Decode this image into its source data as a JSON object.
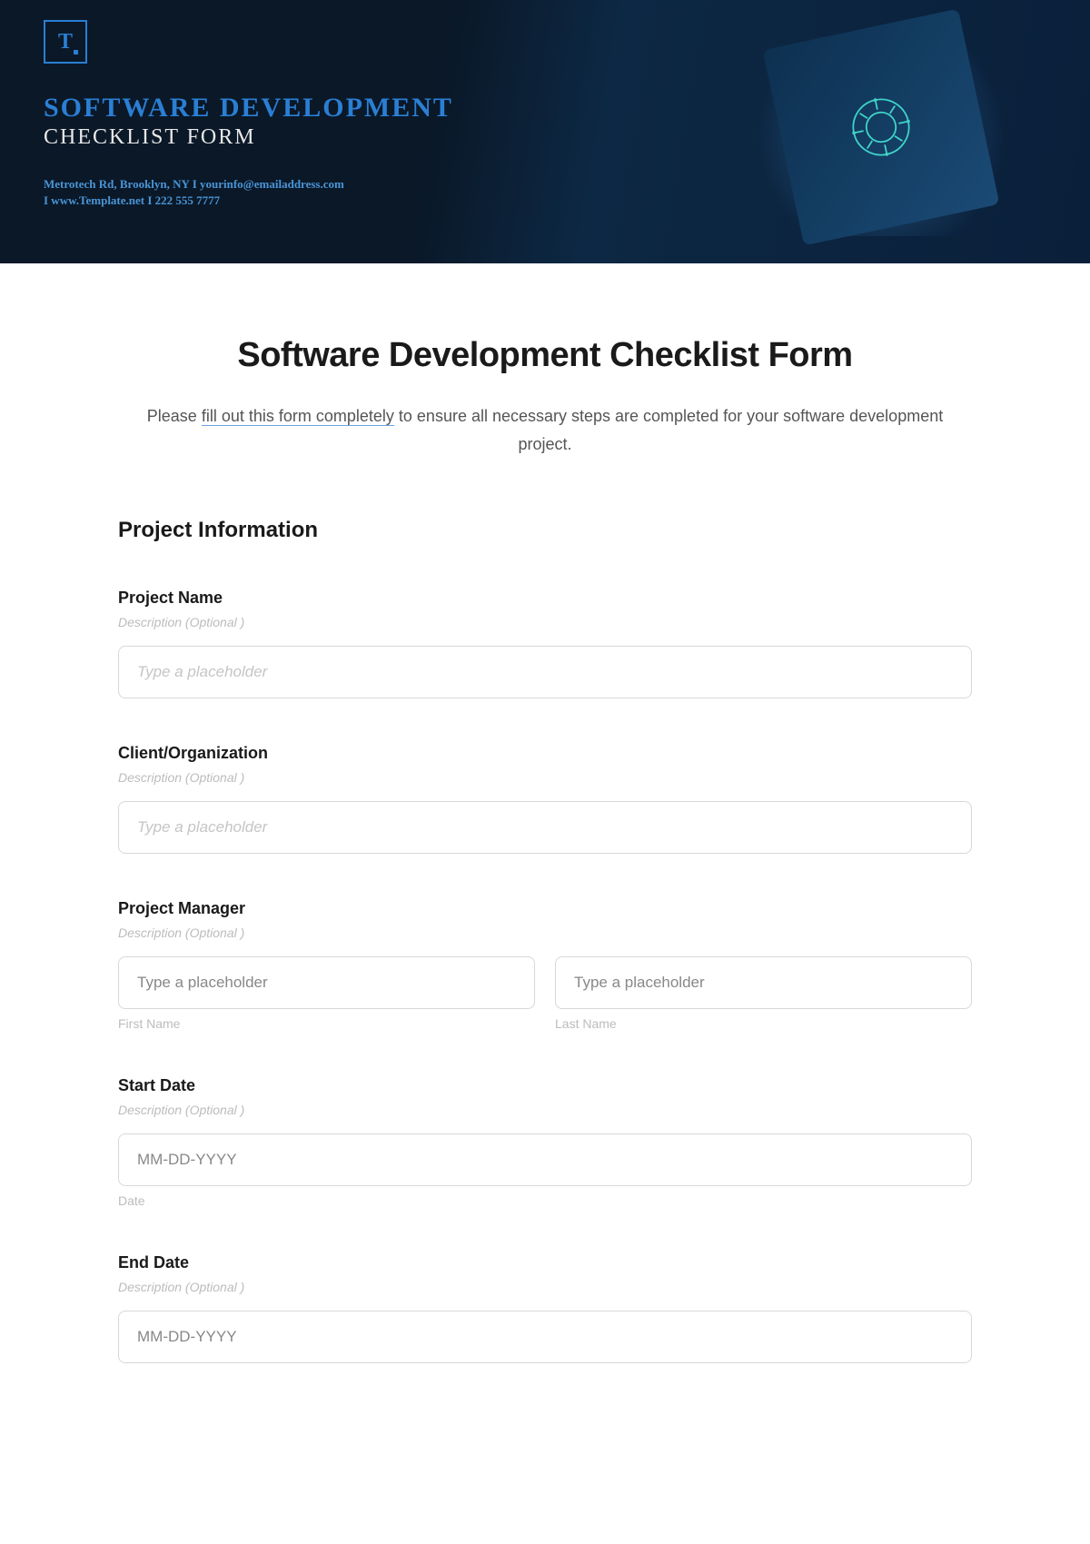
{
  "banner": {
    "logo_letter": "T",
    "title_line1": "SOFTWARE DEVELOPMENT",
    "title_line2": "CHECKLIST FORM",
    "address_line1": "Metrotech Rd, Brooklyn, NY  I  yourinfo@emailaddress.com",
    "address_line2": "I  www.Template.net  I  222 555 7777"
  },
  "form": {
    "title": "Software Development Checklist Form",
    "intro_before": "Please ",
    "intro_linked": "fill out this form completely",
    "intro_after": " to ensure all necessary steps are completed for your software development project.",
    "section_title": "Project Information",
    "fields": {
      "project_name": {
        "label": "Project Name",
        "desc": "Description  (Optional )",
        "placeholder": "Type a placeholder"
      },
      "client_org": {
        "label": "Client/Organization",
        "desc": "Description  (Optional )",
        "placeholder": "Type a placeholder"
      },
      "project_manager": {
        "label": "Project Manager",
        "desc": "Description  (Optional )",
        "first_placeholder": "Type a placeholder",
        "last_placeholder": "Type a placeholder",
        "first_sub": "First Name",
        "last_sub": "Last Name"
      },
      "start_date": {
        "label": "Start Date",
        "desc": "Description  (Optional )",
        "placeholder": "MM-DD-YYYY",
        "sub": "Date"
      },
      "end_date": {
        "label": "End Date",
        "desc": "Description  (Optional )",
        "placeholder": "MM-DD-YYYY"
      }
    }
  }
}
